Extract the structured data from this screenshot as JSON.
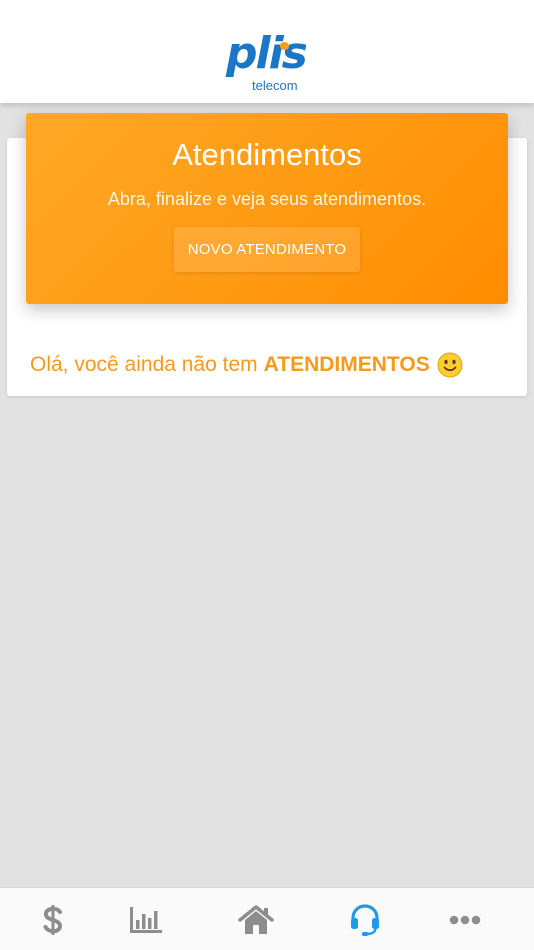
{
  "header": {
    "logo_main": "plis",
    "logo_sub": "telecom"
  },
  "banner": {
    "title": "Atendimentos",
    "subtitle": "Abra, finalize e veja seus atendimentos.",
    "button_label": "NOVO ATENDIMENTO"
  },
  "empty_state": {
    "text": "Olá, você ainda não tem",
    "highlight": "ATENDIMENTOS",
    "emoji_icon": "smiley-icon"
  },
  "bottom_nav": {
    "items": [
      {
        "icon": "dollar-icon",
        "active": false
      },
      {
        "icon": "bar-chart-icon",
        "active": false
      },
      {
        "icon": "home-icon",
        "active": false
      },
      {
        "icon": "headset-icon",
        "active": true
      },
      {
        "icon": "more-icon",
        "active": false
      }
    ]
  },
  "colors": {
    "brand_blue": "#1a77c6",
    "accent_orange": "#f79a1c",
    "nav_active": "#1e9be8",
    "nav_inactive": "#8d8d8d"
  }
}
